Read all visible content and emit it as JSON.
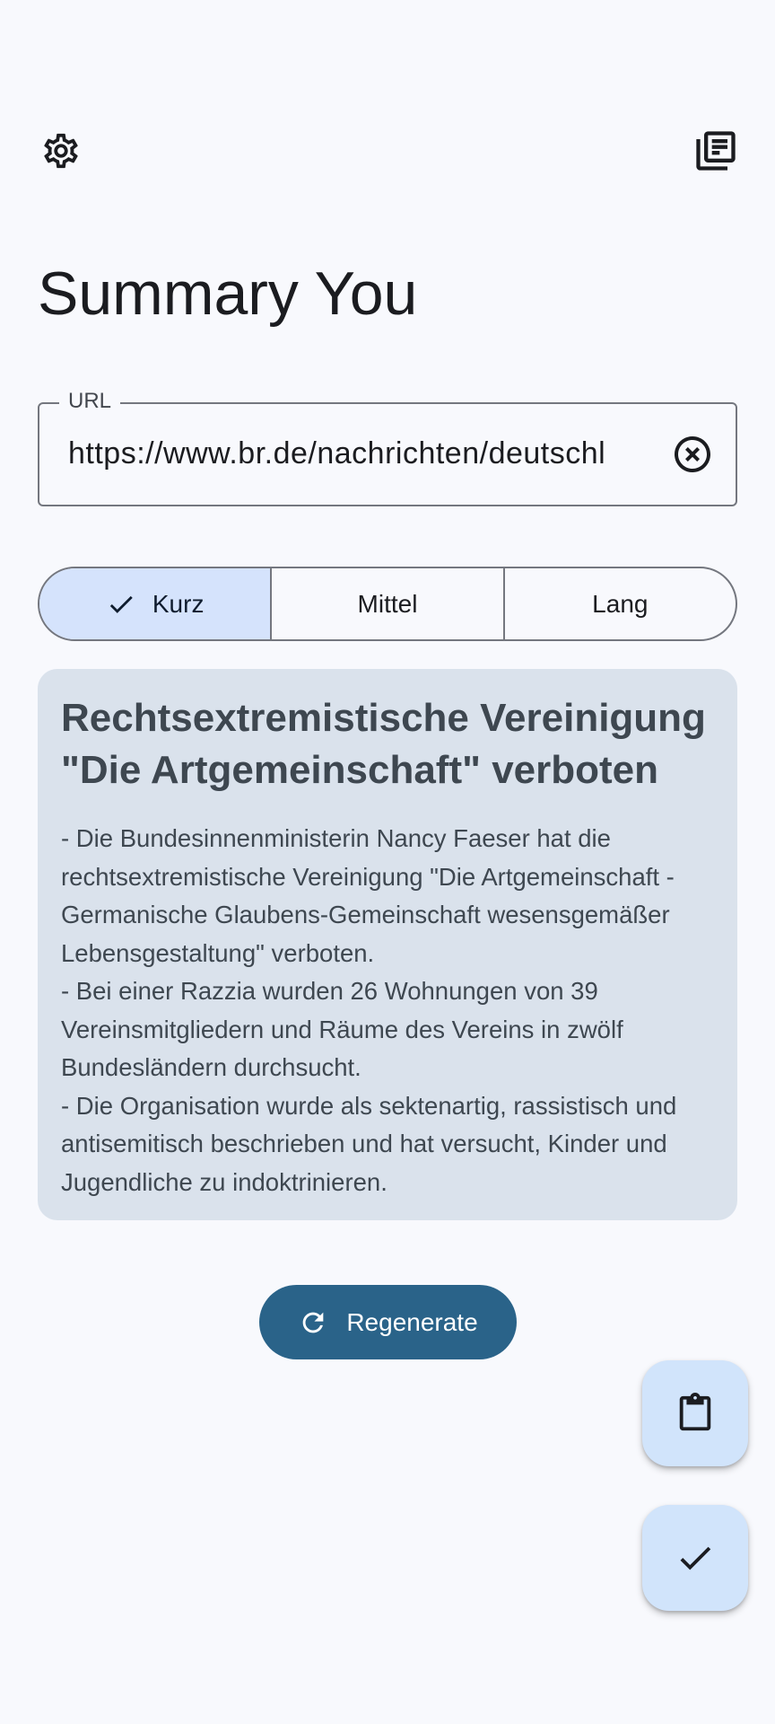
{
  "header": {
    "settings_icon": "settings-icon",
    "history_icon": "history-list-icon"
  },
  "app": {
    "title": "Summary You"
  },
  "url_field": {
    "label": "URL",
    "value": "https://www.br.de/nachrichten/deutschl",
    "clear_icon": "clear-circle-icon"
  },
  "length_selector": {
    "options": [
      {
        "label": "Kurz",
        "selected": true
      },
      {
        "label": "Mittel",
        "selected": false
      },
      {
        "label": "Lang",
        "selected": false
      }
    ]
  },
  "summary": {
    "title": "Rechtsextremistische Vereinigung \"Die Artgemeinschaft\" verboten",
    "text": "- Die Bundesinnenministerin Nancy Faeser hat die rechtsextremistische Vereinigung \"Die Artgemeinschaft - Germanische Glaubens-Gemeinschaft wesensgemäßer Lebensgestaltung\" verboten.\n- Bei einer Razzia wurden 26 Wohnungen von 39 Vereinsmitgliedern und Räume des Vereins in zwölf Bundesländern durchsucht.\n- Die Organisation wurde als sektenartig, rassistisch und antisemitisch beschrieben und hat versucht, Kinder und Jugendliche zu indoktrinieren."
  },
  "actions": {
    "regenerate_label": "Regenerate",
    "regenerate_icon": "refresh-icon",
    "clipboard_icon": "clipboard-icon",
    "done_icon": "check-icon"
  },
  "colors": {
    "background": "#f8f9fd",
    "selected_segment": "#d5e3fc",
    "card": "#dae2ec",
    "primary_button": "#2a6389",
    "fab": "#d1e4fb"
  }
}
